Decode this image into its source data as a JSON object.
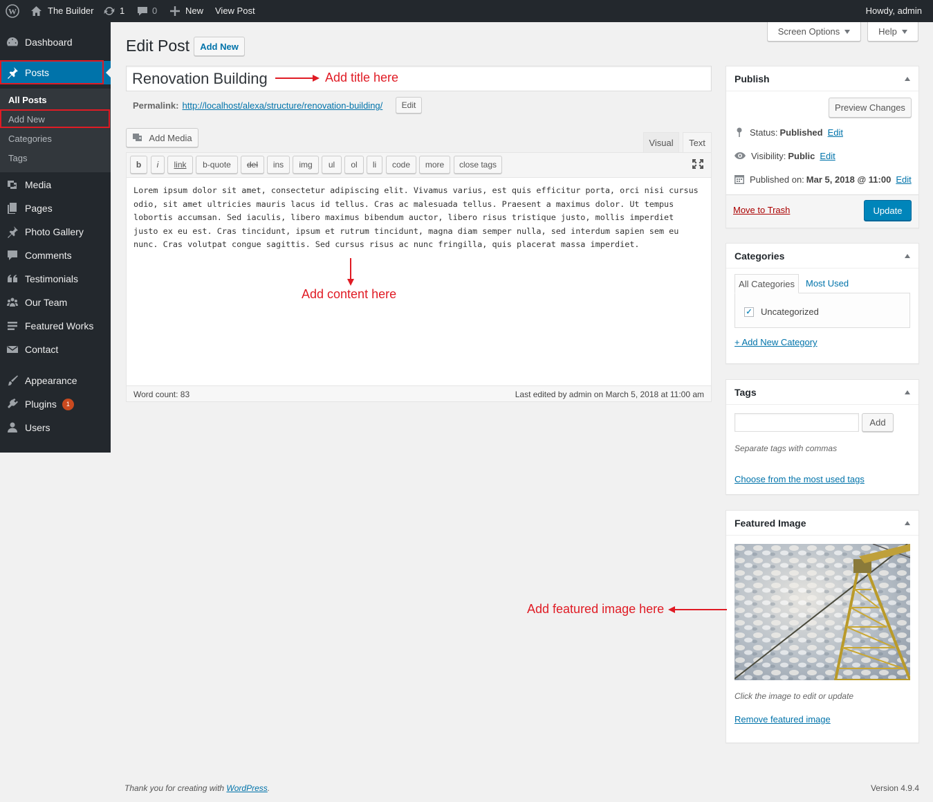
{
  "adminbar": {
    "site_name": "The Builder",
    "updates_count": "1",
    "comments_count": "0",
    "new_label": "New",
    "view_post_label": "View Post",
    "howdy": "Howdy, admin"
  },
  "sidebar": {
    "dashboard": "Dashboard",
    "posts": "Posts",
    "submenu": {
      "all_posts": "All Posts",
      "add_new": "Add New",
      "categories": "Categories",
      "tags": "Tags"
    },
    "media": "Media",
    "pages": "Pages",
    "photo_gallery": "Photo Gallery",
    "comments": "Comments",
    "testimonials": "Testimonials",
    "our_team": "Our Team",
    "featured_works": "Featured Works",
    "contact": "Contact",
    "appearance": "Appearance",
    "plugins": "Plugins",
    "plugins_badge": "1",
    "users": "Users"
  },
  "header": {
    "screen_options": "Screen Options",
    "help": "Help",
    "title": "Edit Post",
    "add_new": "Add New"
  },
  "post": {
    "title": "Renovation Building",
    "permalink_label": "Permalink:",
    "permalink_url": "http://localhost/alexa/structure/renovation-building/",
    "permalink_edit": "Edit",
    "add_media": "Add Media",
    "tab_visual": "Visual",
    "tab_text": "Text",
    "quicktags": [
      "b",
      "i",
      "link",
      "b-quote",
      "del",
      "ins",
      "img",
      "ul",
      "ol",
      "li",
      "code",
      "more",
      "close tags"
    ],
    "content": "Lorem ipsum dolor sit amet, consectetur adipiscing elit. Vivamus varius, est quis efficitur porta, orci nisi cursus odio, sit amet ultricies mauris lacus id tellus. Cras ac malesuada tellus. Praesent a maximus dolor. Ut tempus lobortis accumsan. Sed iaculis, libero maximus bibendum auctor, libero risus tristique justo, mollis imperdiet justo ex eu est. Cras tincidunt, ipsum et rutrum tincidunt, magna diam semper nulla, sed interdum sapien sem eu nunc. Cras volutpat congue sagittis. Sed cursus risus ac nunc fringilla, quis placerat massa imperdiet.",
    "word_count": "Word count: 83",
    "last_edited": "Last edited by admin on March 5, 2018 at 11:00 am"
  },
  "annotations": {
    "title": "Add title here",
    "content": "Add content here",
    "image": "Add featured image here"
  },
  "publish": {
    "heading": "Publish",
    "preview": "Preview Changes",
    "status_label": "Status:",
    "status_value": "Published",
    "visibility_label": "Visibility:",
    "visibility_value": "Public",
    "published_label": "Published on:",
    "published_value": "Mar 5, 2018 @ 11:00",
    "edit": "Edit",
    "trash": "Move to Trash",
    "update": "Update"
  },
  "categories": {
    "heading": "Categories",
    "tab_all": "All Categories",
    "tab_most_used": "Most Used",
    "item": "Uncategorized",
    "add_new": "+ Add New Category"
  },
  "tags": {
    "heading": "Tags",
    "add": "Add",
    "hint": "Separate tags with commas",
    "choose": "Choose from the most used tags"
  },
  "featured": {
    "heading": "Featured Image",
    "hint": "Click the image to edit or update",
    "remove": "Remove featured image"
  },
  "footer": {
    "thanks": "Thank you for creating with",
    "wordpress": "WordPress",
    "period": ".",
    "version": "Version 4.9.4"
  },
  "colors": {
    "primary": "#0073aa",
    "sidebar": "#23282d",
    "annotation": "#e01b24"
  }
}
